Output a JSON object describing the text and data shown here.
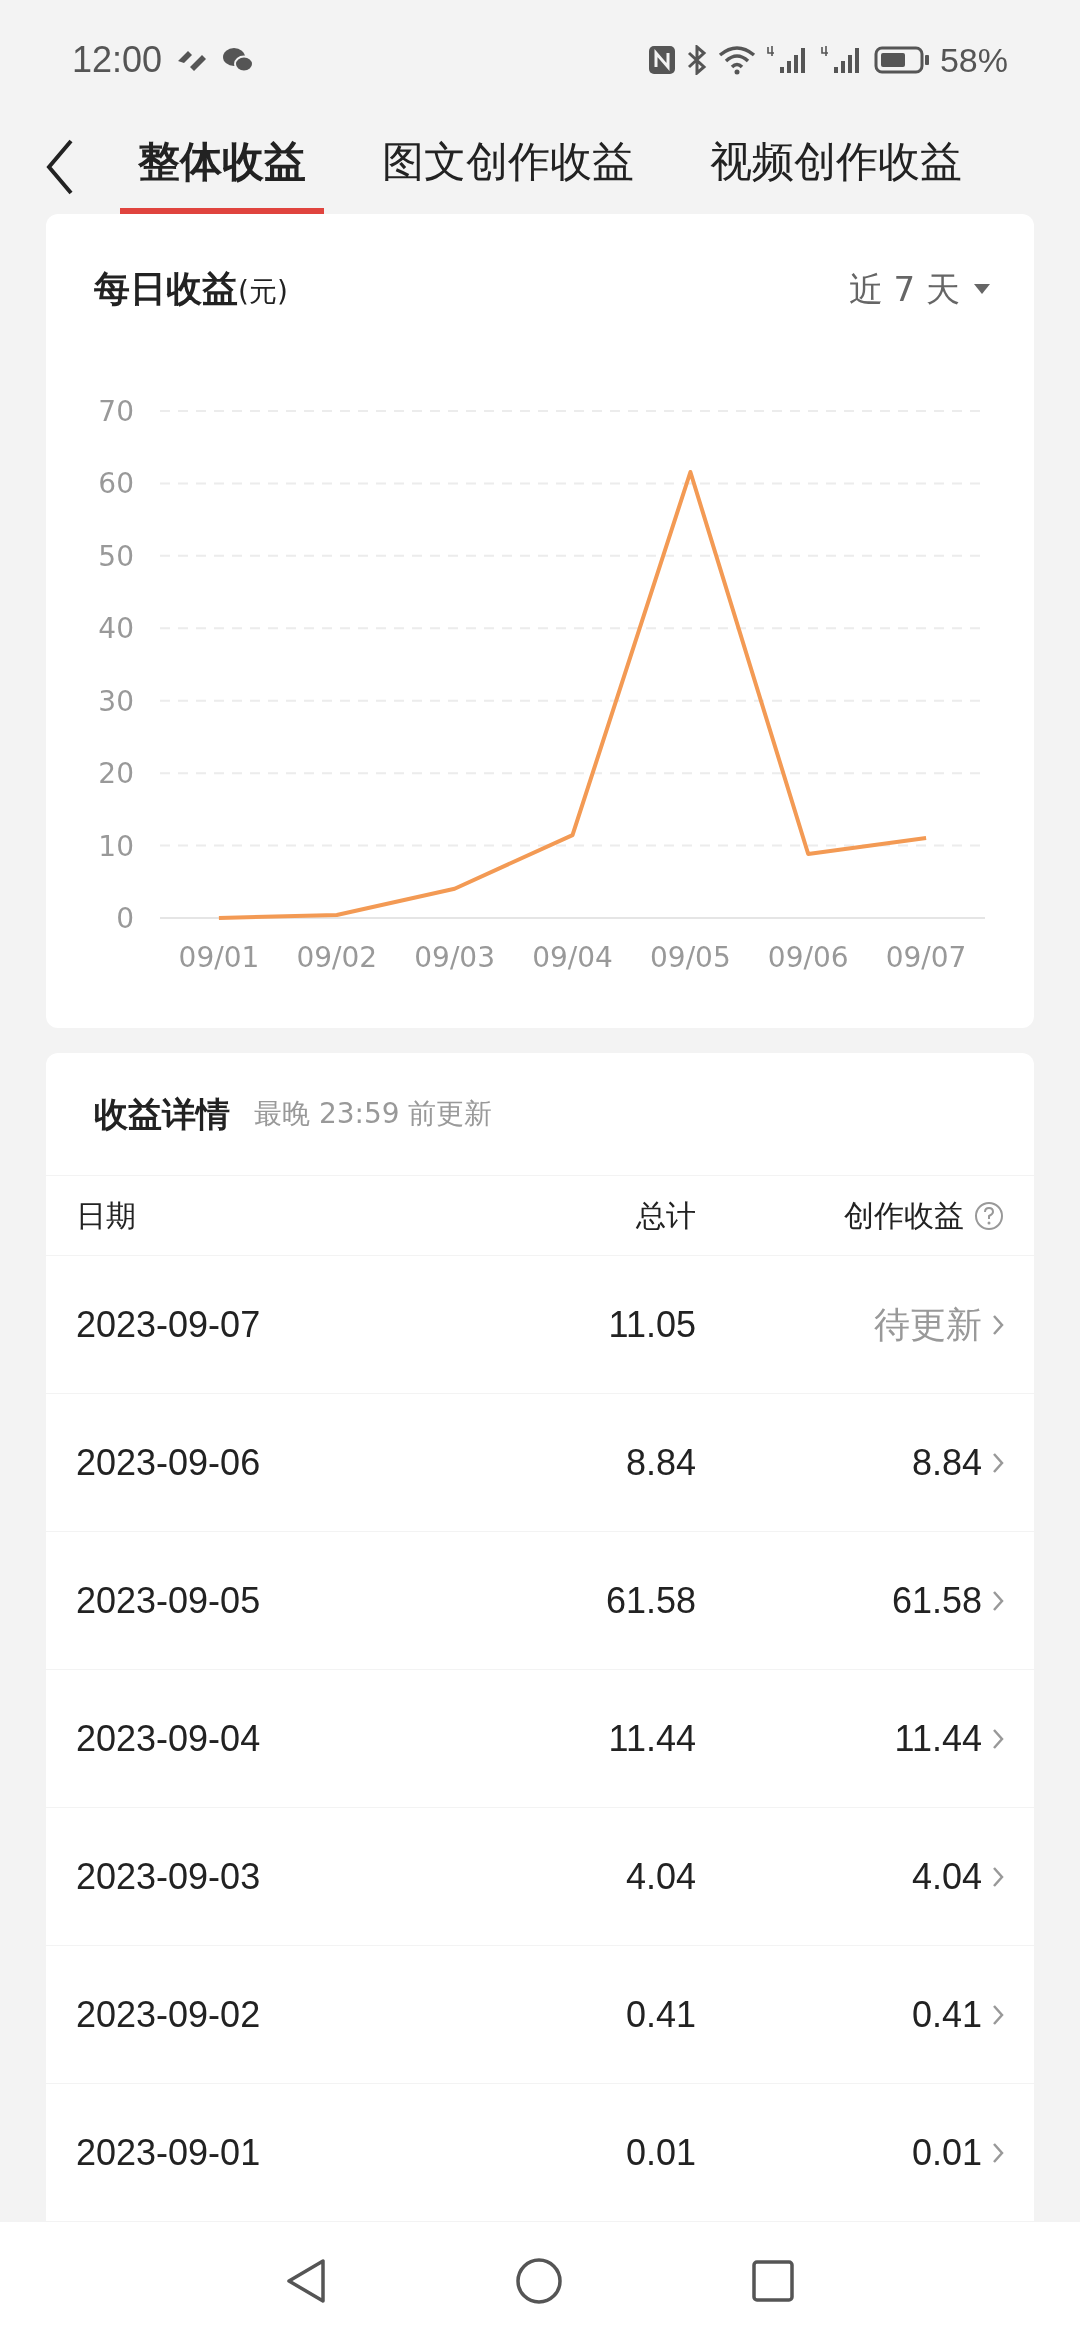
{
  "status_bar": {
    "time": "12:00",
    "battery": "58%"
  },
  "tabs": [
    {
      "label": "整体收益",
      "selected": true
    },
    {
      "label": "图文创作收益",
      "selected": false
    },
    {
      "label": "视频创作收益",
      "selected": false
    }
  ],
  "chart_card": {
    "title": "每日收益",
    "unit": "(元)",
    "range": "近 7 天",
    "chart_data": {
      "type": "line",
      "categories": [
        "09/01",
        "09/02",
        "09/03",
        "09/04",
        "09/05",
        "09/06",
        "09/07"
      ],
      "grid": true,
      "series": [
        {
          "color": "#f39a54",
          "values": [
            0.01,
            0.41,
            4.04,
            11.44,
            61.58,
            8.84,
            11.05
          ]
        }
      ],
      "ylim": [
        0,
        70
      ],
      "yticks": [
        0,
        10,
        20,
        30,
        40,
        50,
        60,
        70
      ]
    }
  },
  "details": {
    "title": "收益详情",
    "note": "最晚 23:59 前更新",
    "columns": [
      "日期",
      "总计",
      "创作收益"
    ],
    "rows": [
      {
        "date": "2023-09-07",
        "total": "11.05",
        "creation": "待更新",
        "pending": true
      },
      {
        "date": "2023-09-06",
        "total": "8.84",
        "creation": "8.84",
        "pending": false
      },
      {
        "date": "2023-09-05",
        "total": "61.58",
        "creation": "61.58",
        "pending": false
      },
      {
        "date": "2023-09-04",
        "total": "11.44",
        "creation": "11.44",
        "pending": false
      },
      {
        "date": "2023-09-03",
        "total": "4.04",
        "creation": "4.04",
        "pending": false
      },
      {
        "date": "2023-09-02",
        "total": "0.41",
        "creation": "0.41",
        "pending": false
      },
      {
        "date": "2023-09-01",
        "total": "0.01",
        "creation": "0.01",
        "pending": false
      }
    ]
  }
}
